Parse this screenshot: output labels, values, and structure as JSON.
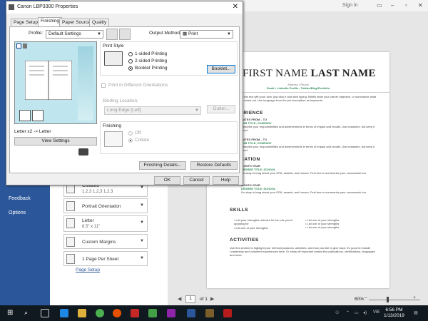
{
  "word": {
    "signin": "Sign in",
    "nav": {
      "feedback": "Feedback",
      "options": "Options"
    },
    "settings": [
      {
        "line1": "Collated",
        "line2": "1,2,3    1,2,3    1,2,3"
      },
      {
        "line1": "Portrait Orientation"
      },
      {
        "line1": "Letter",
        "line2": "8.5\" x 11\""
      },
      {
        "line1": "Custom Margins"
      },
      {
        "line1": "1 Page Per Sheet"
      }
    ],
    "page_setup_link": "Page Setup",
    "page_input": "1",
    "page_of": "of 1",
    "zoom": "60%"
  },
  "doc": {
    "name_first": "FIRST NAME",
    "name_last": "LAST NAME",
    "address": "Address • Phone",
    "links": "Email • LinkedIn Profile • Twitter/Blog/Portfolio",
    "intro": "To replace this text with your own, just click it and start typing. Briefly state your career objective, or summarize what makes you stand out. Use language from the job description as keywords.",
    "experience": "EXPERIENCE",
    "dates1": "DATES FROM – TO",
    "job1": "JOB TITLE, COMPANY",
    "job_desc": "Describe your responsibilities and achievements in terms of impact and results. Use examples, but keep it short.",
    "dates2": "DATES FROM – TO",
    "job2": "JOB TITLE, COMPANY",
    "education": "EDUCATION",
    "month_year1": "MONTH YEAR",
    "degree1": "DEGREE TITLE, SCHOOL",
    "edu_desc": "It's okay to brag about your GPA, awards, and honors. Feel free to summarize your coursework too.",
    "month_year2": "MONTH YEAR",
    "degree2": "DEGREE TITLE, SCHOOL",
    "skills": "SKILLS",
    "skill1": "List your strengths relevant for the role you're applying for",
    "skill2": "List one of your strengths",
    "skill3": "List one of your strengths",
    "skill4": "List one of your strengths",
    "skill5": "List one of your strengths",
    "activities": "ACTIVITIES",
    "act_desc": "Use this section to highlight your relevant passions, activities, and how you like to give back. It's good to include Leadership and volunteer experiences here. Or show off important extras like publications, certifications, languages and more."
  },
  "dialog": {
    "title": "Canon LBP3300 Properties",
    "tabs": [
      "Page Setup",
      "Finishing",
      "Paper Source",
      "Quality"
    ],
    "profile_label": "Profile:",
    "profile_value": "Default Settings",
    "output_label": "Output Method:",
    "output_value": "Print",
    "preview_caption": "Letter x2 -> Letter",
    "view_settings": "View Settings",
    "print_style_label": "Print Style",
    "radio_1sided": "1-sided Printing",
    "radio_2sided": "2-sided Printing",
    "radio_booklet": "Booklet Printing",
    "booklet_btn": "Booklet...",
    "print_diff_orient": "Print in Different Orientations",
    "binding_label": "Binding Location:",
    "binding_value": "Long Edge [Left]",
    "gutter_btn": "Gutter...",
    "finishing_label": "Finishing",
    "radio_off": "Off",
    "radio_collate": "Collate",
    "finishing_details_btn": "Finishing Details...",
    "restore_btn": "Restore Defaults",
    "ok": "OK",
    "cancel": "Cancel",
    "help": "Help"
  },
  "taskbar": {
    "time": "6:56 PM",
    "date": "1/13/2019",
    "lang": "VIE"
  }
}
